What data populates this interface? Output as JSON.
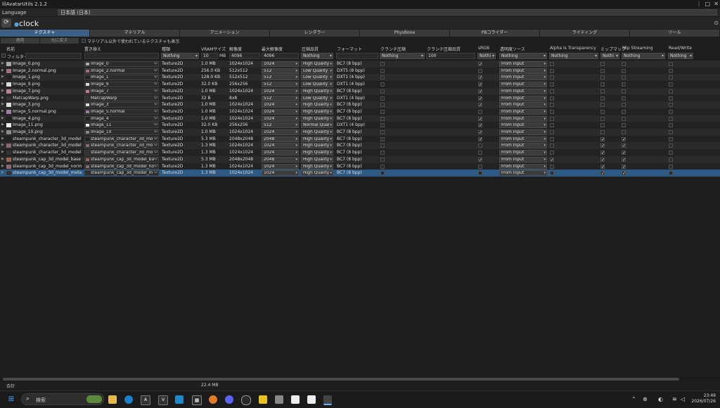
{
  "window": {
    "title": "lilAvatarUtils 2.1.2",
    "menu_icon": "⋮",
    "maximize_icon": "□",
    "close_icon": "✕"
  },
  "language": {
    "label": "Language",
    "value": "日本語 (日本)"
  },
  "avatar": {
    "name": "clock",
    "target_icon": "⊙",
    "refresh_icon": "⟳"
  },
  "tabs": [
    "テクスチャ",
    "マテリアル",
    "アニメーション",
    "レンダラー",
    "PhysBone",
    "PBコライダー",
    "ライティング",
    "ツール"
  ],
  "actions": {
    "apply": "適用",
    "revert": "元に戻す",
    "show_unused": "マテリアル以外で使われているテクスチャも表示"
  },
  "headers": {
    "name": "名前",
    "replace": "置き換え",
    "type": "種類",
    "vram": "VRAMサイズ",
    "resolution": "解像度",
    "max_res": "最大解像度",
    "compression": "圧縮品質",
    "format": "フォーマット",
    "crunch": "クランチ圧縮",
    "crunch_q": "クランチ圧縮品質",
    "srgb": "sRGB",
    "alpha_src": "透明度ソース",
    "alpha_trans": "Alpha Is Transparency",
    "mipmap": "ミップマップ",
    "mip_stream": "Mip Streaming",
    "readwrite": "Read/Write"
  },
  "filters": {
    "filter_label": "フィルター",
    "type": "Nothing",
    "vram": "10",
    "vram_unit": "MB",
    "res": "4096",
    "max_res": "4096",
    "compression": "Nothing",
    "crunch": "Nothing",
    "crunch_q": "100",
    "srgb": "Nothi",
    "alpha_src": "Nothing",
    "alpha_trans": "Nothing",
    "mipmap": "Nothi",
    "mip_stream": "Nothing",
    "readwrite": "Nothing"
  },
  "rows": [
    {
      "name": "Image_0.png",
      "rep": "Image_0",
      "type": "Texture2D",
      "vram": "1.0 MB",
      "res": "1024x1024",
      "max": "1024",
      "q": "High Quality",
      "fmt": "BC7 (8 bpp)",
      "crunch": false,
      "srgb": true,
      "asrc": "From Input",
      "at": false,
      "mip": false,
      "ms": false,
      "rw": false,
      "tc": "#aaaaaa"
    },
    {
      "name": "Image_2.normal.png",
      "rep": "Image_2.normal",
      "type": "Texture2D",
      "vram": "256.0 KB",
      "res": "512x512",
      "max": "512",
      "q": "Low Quality",
      "fmt": "DXT5 (8 bpp)",
      "crunch": false,
      "srgb": false,
      "asrc": "From Input",
      "at": false,
      "mip": false,
      "ms": false,
      "rw": false,
      "tc": "#a07080"
    },
    {
      "name": "Image_1.png",
      "rep": "Image_1",
      "type": "Texture2D",
      "vram": "128.0 KB",
      "res": "512x512",
      "max": "512",
      "q": "Low Quality",
      "fmt": "DXT1 (4 bpp)",
      "crunch": false,
      "srgb": true,
      "asrc": "From Input",
      "at": false,
      "mip": false,
      "ms": false,
      "rw": false,
      "tc": "#222222"
    },
    {
      "name": "Image_9.png",
      "rep": "Image_9",
      "type": "Texture2D",
      "vram": "32.0 KB",
      "res": "256x256",
      "max": "512",
      "q": "Low Quality",
      "fmt": "DXT1 (4 bpp)",
      "crunch": false,
      "srgb": true,
      "asrc": "From Input",
      "at": false,
      "mip": false,
      "ms": false,
      "rw": false,
      "tc": "#dddddd"
    },
    {
      "name": "Image_7.png",
      "rep": "Image_7",
      "type": "Texture2D",
      "vram": "1.0 MB",
      "res": "1024x1024",
      "max": "1024",
      "q": "High Quality",
      "fmt": "BC7 (8 bpp)",
      "crunch": false,
      "srgb": true,
      "asrc": "From Input",
      "at": false,
      "mip": false,
      "ms": false,
      "rw": false,
      "tc": "#c08090"
    },
    {
      "name": "MatcapWarp.png",
      "rep": "MatcapWarp",
      "type": "Texture2D",
      "vram": "32 B",
      "res": "8x8",
      "max": "512",
      "q": "Low Quality",
      "fmt": "DXT1 (4 bpp)",
      "crunch": false,
      "srgb": true,
      "asrc": "From Input",
      "at": false,
      "mip": false,
      "ms": false,
      "rw": false,
      "tc": "#333333"
    },
    {
      "name": "Image_3.png",
      "rep": "Image_3",
      "type": "Texture2D",
      "vram": "1.0 MB",
      "res": "1024x1024",
      "max": "1024",
      "q": "High Quality",
      "fmt": "BC7 (8 bpp)",
      "crunch": false,
      "srgb": true,
      "asrc": "From Input",
      "at": false,
      "mip": false,
      "ms": false,
      "rw": false,
      "tc": "#dddddd"
    },
    {
      "name": "Image_5.normal.png",
      "rep": "Image_5.normal",
      "type": "Texture2D",
      "vram": "1.0 MB",
      "res": "1024x1024",
      "max": "1024",
      "q": "High Quality",
      "fmt": "BC7 (8 bpp)",
      "crunch": false,
      "srgb": false,
      "asrc": "From Input",
      "at": false,
      "mip": false,
      "ms": false,
      "rw": false,
      "tc": "#9a7fa0"
    },
    {
      "name": "Image_4.png",
      "rep": "Image_4",
      "type": "Texture2D",
      "vram": "1.0 MB",
      "res": "1024x1024",
      "max": "1024",
      "q": "High Quality",
      "fmt": "BC7 (8 bpp)",
      "crunch": false,
      "srgb": true,
      "asrc": "From Input",
      "at": false,
      "mip": false,
      "ms": false,
      "rw": false,
      "tc": "#222222"
    },
    {
      "name": "Image_11.png",
      "rep": "Image_11",
      "type": "Texture2D",
      "vram": "32.0 KB",
      "res": "256x256",
      "max": "512",
      "q": "Normal Qual",
      "fmt": "DXT1 (4 bpp)",
      "crunch": false,
      "srgb": true,
      "asrc": "From Input",
      "at": false,
      "mip": false,
      "ms": false,
      "rw": false,
      "tc": "#eeeeee"
    },
    {
      "name": "Image_10.png",
      "rep": "Image_10",
      "type": "Texture2D",
      "vram": "1.0 MB",
      "res": "1024x1024",
      "max": "1024",
      "q": "High Quality",
      "fmt": "BC7 (8 bpp)",
      "crunch": false,
      "srgb": true,
      "asrc": "From Input",
      "at": false,
      "mip": false,
      "ms": false,
      "rw": false,
      "tc": "#888888"
    },
    {
      "name": "steampunk_character_3d_model",
      "rep": "steampunk_character_3d_mo",
      "type": "Texture2D",
      "vram": "5.3 MB",
      "res": "2048x2048",
      "max": "2048",
      "q": "High Quality",
      "fmt": "BC7 (8 bpp)",
      "crunch": false,
      "srgb": true,
      "asrc": "From Input",
      "at": false,
      "mip": true,
      "ms": true,
      "rw": false,
      "tc": "#222222"
    },
    {
      "name": "steampunk_character_3d_model",
      "rep": "steampunk_character_3d_mo",
      "type": "Texture2D",
      "vram": "1.3 MB",
      "res": "1024x1024",
      "max": "1024",
      "q": "High Quality",
      "fmt": "BC7 (8 bpp)",
      "crunch": false,
      "srgb": false,
      "asrc": "From Input",
      "at": false,
      "mip": true,
      "ms": true,
      "rw": false,
      "tc": "#8a6a70"
    },
    {
      "name": "steampunk_character_3d_model",
      "rep": "steampunk_character_3d_mo",
      "type": "Texture2D",
      "vram": "1.3 MB",
      "res": "1024x1024",
      "max": "1024",
      "q": "High Quality",
      "fmt": "BC7 (8 bpp)",
      "crunch": false,
      "srgb": false,
      "asrc": "From Input",
      "at": false,
      "mip": true,
      "ms": true,
      "rw": false,
      "tc": "#333333"
    },
    {
      "name": "steampunk_cap_3d_model_base",
      "rep": "steampunk_cap_3d_model_ba",
      "type": "Texture2D",
      "vram": "5.3 MB",
      "res": "2048x2048",
      "max": "2048",
      "q": "High Quality",
      "fmt": "BC7 (8 bpp)",
      "crunch": false,
      "srgb": true,
      "asrc": "From Input",
      "at": true,
      "mip": true,
      "ms": true,
      "rw": false,
      "tc": "#996655"
    },
    {
      "name": "steampunk_cap_3d_model_norm",
      "rep": "steampunk_cap_3d_model_no",
      "type": "Texture2D",
      "vram": "1.3 MB",
      "res": "1024x1024",
      "max": "1024",
      "q": "High Quality",
      "fmt": "BC7 (8 bpp)",
      "crunch": false,
      "srgb": false,
      "asrc": "From Input",
      "at": false,
      "mip": true,
      "ms": true,
      "rw": false,
      "tc": "#8a6a70"
    },
    {
      "name": "steampunk_cap_3d_model_meta",
      "rep": "steampunk_cap_3d_model_m",
      "type": "Texture2D",
      "vram": "1.3 MB",
      "res": "1024x1024",
      "max": "1024",
      "q": "High Quality",
      "fmt": "BC7 (8 bpp)",
      "crunch": false,
      "srgb": false,
      "asrc": "From Input",
      "at": false,
      "mip": true,
      "ms": true,
      "rw": false,
      "tc": "#333333",
      "selected": true
    }
  ],
  "footer": {
    "total_label": "合計",
    "total": "22.4 MB"
  },
  "taskbar": {
    "search_label": "検索",
    "time": "23:49",
    "date": "2026/07/26"
  },
  "icon_names": {
    "pick": "⊙",
    "check": "✓",
    "expand": "▶",
    "search": "🔍"
  }
}
